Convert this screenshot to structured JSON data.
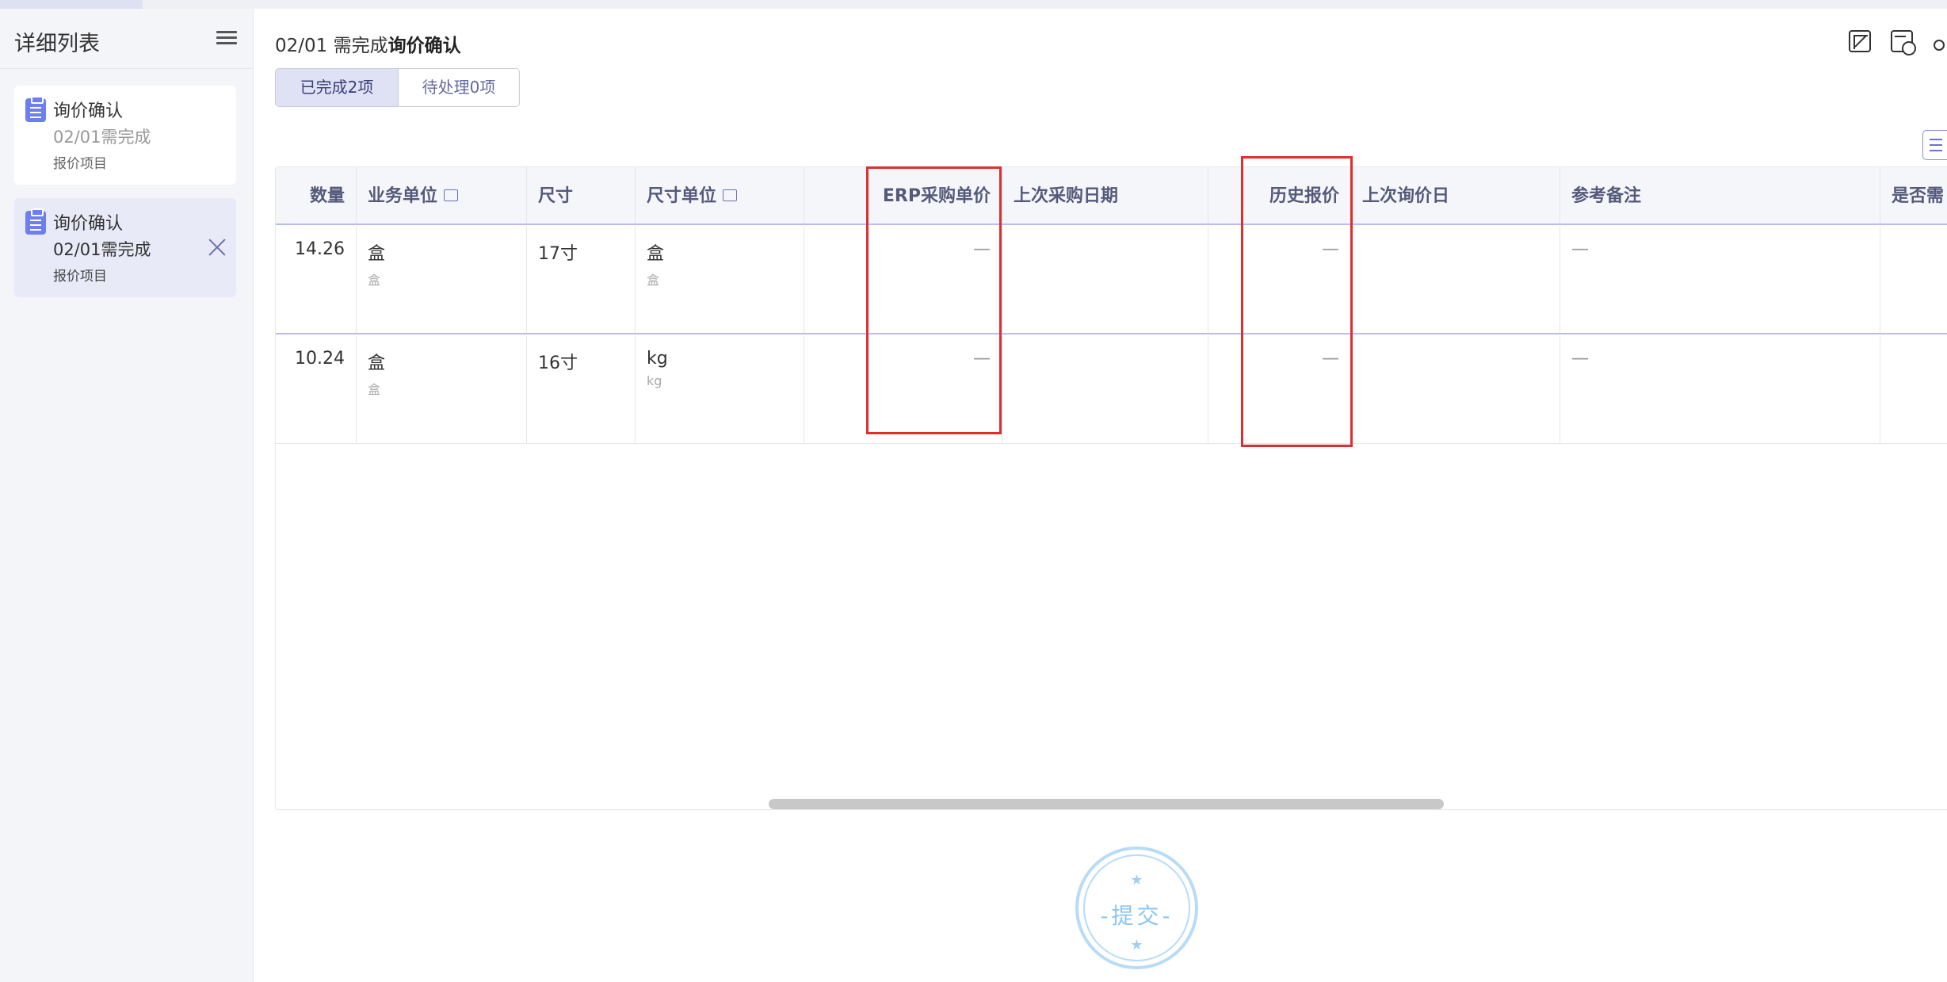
{
  "sidebar": {
    "title": "详细列表",
    "items": [
      {
        "title": "询价确认",
        "date": "02/01需完成",
        "sub": "报价项目"
      },
      {
        "title": "询价确认",
        "date": "02/01需完成",
        "sub": "报价项目"
      }
    ]
  },
  "header": {
    "date": "02/01 需完成",
    "title": "询价确认"
  },
  "tabs": {
    "done": "已完成2项",
    "pending": "待处理0项"
  },
  "table": {
    "columns": {
      "qty": "数量",
      "biz_unit": "业务单位",
      "size": "尺寸",
      "size_unit": "尺寸单位",
      "erp_price": "ERP采购单价",
      "last_purchase_date": "上次采购日期",
      "history_price": "历史报价",
      "last_inquiry_date": "上次询价日",
      "ref_note": "参考备注",
      "need": "是否需"
    },
    "rows": [
      {
        "qty": "14.26",
        "biz_unit": "盒",
        "biz_unit_sub": "盒",
        "size": "17寸",
        "size_unit": "盒",
        "size_unit_sub": "盒",
        "erp_price": "—",
        "history_price": "—",
        "ref_note": "—"
      },
      {
        "qty": "10.24",
        "biz_unit": "盒",
        "biz_unit_sub": "盒",
        "size": "16寸",
        "size_unit": "kg",
        "size_unit_sub": "kg",
        "erp_price": "—",
        "history_price": "—",
        "ref_note": "—"
      }
    ]
  },
  "stamp": {
    "text": "-提交-",
    "star": "★"
  }
}
